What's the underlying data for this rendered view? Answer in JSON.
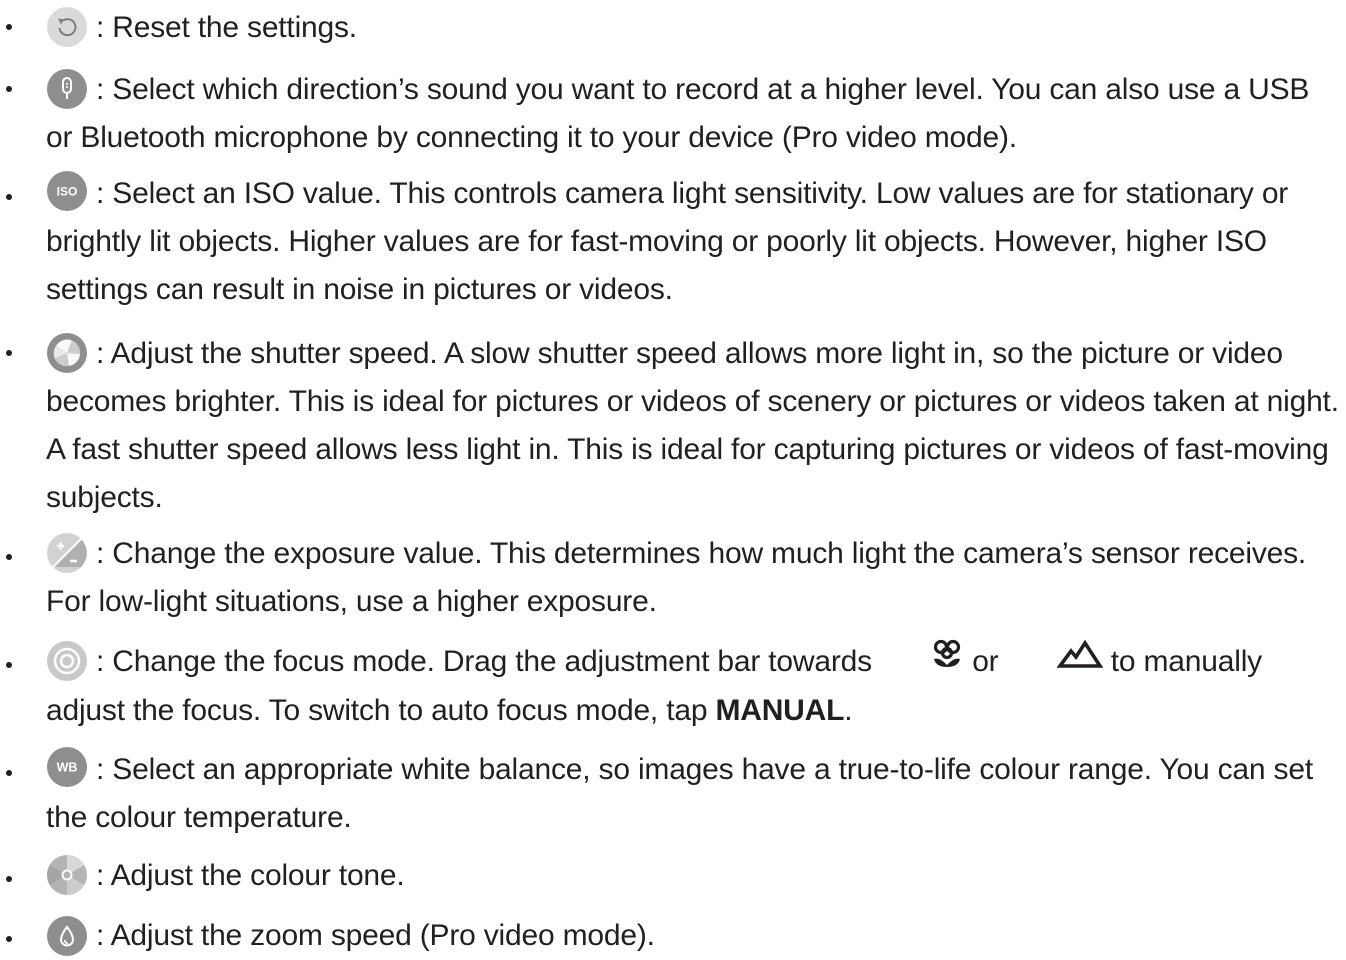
{
  "items": [
    {
      "icon": "reset-icon",
      "text": ": Reset the settings."
    },
    {
      "icon": "microphone-icon",
      "text": ": Select which direction’s sound you want to record at a higher level. You can also use a USB or Bluetooth microphone by connecting it to your device (Pro video mode)."
    },
    {
      "icon": "iso-icon",
      "icon_label": "ISO",
      "text": ": Select an ISO value. This controls camera light sensitivity. Low values are for stationary or brightly lit objects. Higher values are for fast-moving or poorly lit objects. However, higher ISO settings can result in noise in pictures or videos."
    },
    {
      "icon": "shutter-speed-icon",
      "text": ": Adjust the shutter speed. A slow shutter speed allows more light in, so the picture or video becomes brighter. This is ideal for pictures or videos of scenery or pictures or videos taken at night. A fast shutter speed allows less light in. This is ideal for capturing pictures or videos of fast-moving subjects."
    },
    {
      "icon": "exposure-icon",
      "text": ": Change the exposure value. This determines how much light the camera’s sensor receives. For low-light situations, use a higher exposure."
    },
    {
      "icon": "focus-icon",
      "text_a": ": Change the focus mode. Drag the adjustment bar towards",
      "macro_icon": "macro-flower-icon",
      "text_b": "or",
      "landscape_icon": "landscape-mountain-icon",
      "text_c": "to manually adjust the focus. To switch to auto focus mode, tap",
      "bold": "MANUAL",
      "text_d": "."
    },
    {
      "icon": "white-balance-icon",
      "icon_label": "WB",
      "text": ": Select an appropriate white balance, so images have a true-to-life colour range. You can set the colour temperature."
    },
    {
      "icon": "colour-tone-icon",
      "text": ": Adjust the colour tone."
    },
    {
      "icon": "zoom-speed-icon",
      "text": ": Adjust the zoom speed (Pro video mode)."
    }
  ],
  "colors": {
    "text": "#231f20",
    "icon_dark": "#8e8e8e",
    "icon_light": "#d2d2d2"
  }
}
